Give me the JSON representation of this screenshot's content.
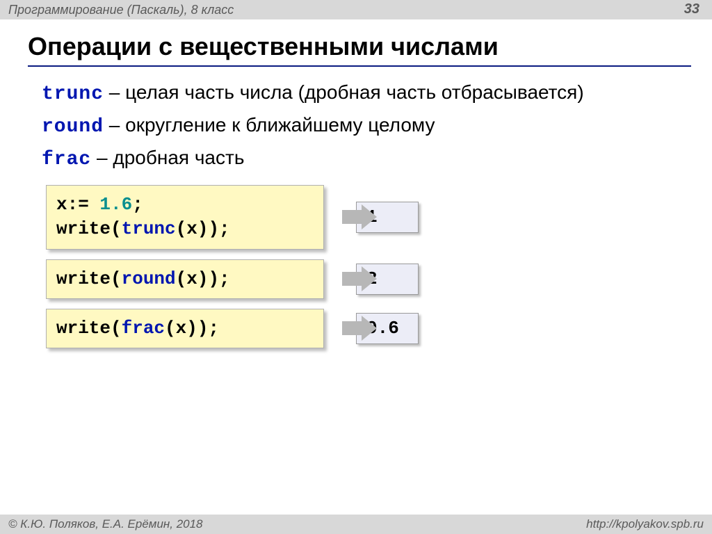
{
  "header": {
    "breadcrumb": "Программирование (Паскаль), 8 класс",
    "page_number": "33"
  },
  "title": "Операции с вещественными числами",
  "definitions": [
    {
      "keyword": "trunc",
      "desc": " – целая часть числа (дробная часть отбрасывается)"
    },
    {
      "keyword": "round",
      "desc": " – округление к ближайшему целому"
    },
    {
      "keyword": "frac",
      "desc": " – дробная часть"
    }
  ],
  "examples": [
    {
      "code_pre": "x:= ",
      "code_num": "1.6",
      "code_mid": ";\nwrite(",
      "code_fn": "trunc",
      "code_post": "(x));",
      "output": "1",
      "tall": true
    },
    {
      "code_pre": "write(",
      "code_num": "",
      "code_mid": "",
      "code_fn": "round",
      "code_post": "(x));",
      "output": "2",
      "tall": false
    },
    {
      "code_pre": "write(",
      "code_num": "",
      "code_mid": "",
      "code_fn": "frac",
      "code_post": "(x));",
      "output": "0.6",
      "tall": false
    }
  ],
  "footer": {
    "copyright": "© К.Ю. Поляков, Е.А. Ерёмин, 2018",
    "url": "http://kpolyakov.spb.ru"
  }
}
